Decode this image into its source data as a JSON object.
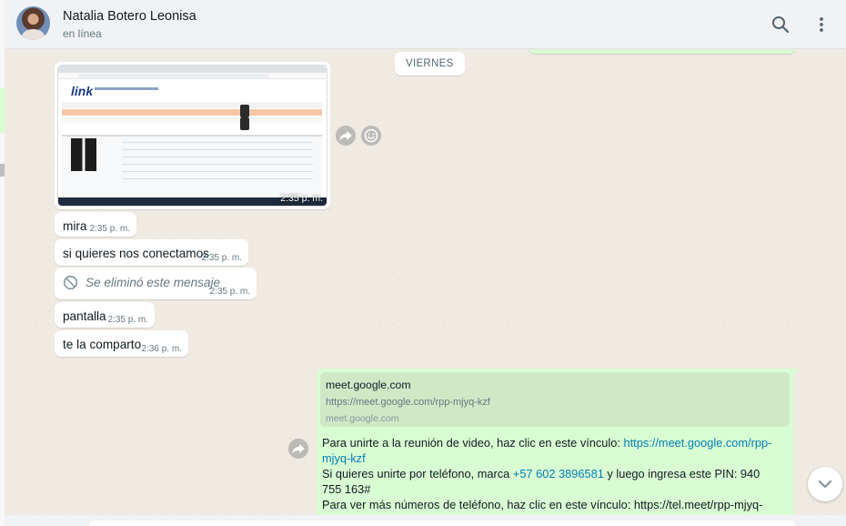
{
  "header": {
    "contact_name": "Natalia Botero Leonisa",
    "status": "en línea",
    "search_icon": "search-icon",
    "menu_icon": "kebab-menu-icon"
  },
  "chat": {
    "date_chip": "VIERNES",
    "image_message": {
      "time": "2:35 p. m."
    },
    "incoming": [
      {
        "text": "mira",
        "time": "2:35 p. m."
      },
      {
        "text": "si quieres nos conectamos",
        "time": "2:35 p. m."
      },
      {
        "text": "Se eliminó este mensaje",
        "time": "2:35 p. m.",
        "deleted": true
      },
      {
        "text": "pantalla",
        "time": "2:35 p. m."
      },
      {
        "text": "te la comparto",
        "time": "2:36 p. m."
      }
    ],
    "outgoing": {
      "preview_title": "meet.google.com",
      "preview_url": "https://meet.google.com/rpp-mjyq-kzf",
      "preview_host": "meet.google.com",
      "line1_text": "Para unirte a la reunión de video, haz clic en este vínculo: ",
      "line1_link": "https://meet.google.com/rpp-mjyq-kzf",
      "line2_text_a": "Si quieres unirte por teléfono, marca ",
      "line2_phone": "+57 602 3896581",
      "line2_text_b": " y luego ingresa este PIN: 940 755 163#",
      "line3_text": "Para ver más números de teléfono, haz clic en este vínculo: https://tel.meet/rpp-mjyq-kzf?"
    },
    "colors": {
      "chat_bg": "#efeae2",
      "incoming_bubble": "#ffffff",
      "outgoing_bubble": "#d9fdd3",
      "link": "#027eb5",
      "timestamp": "#667781"
    }
  }
}
